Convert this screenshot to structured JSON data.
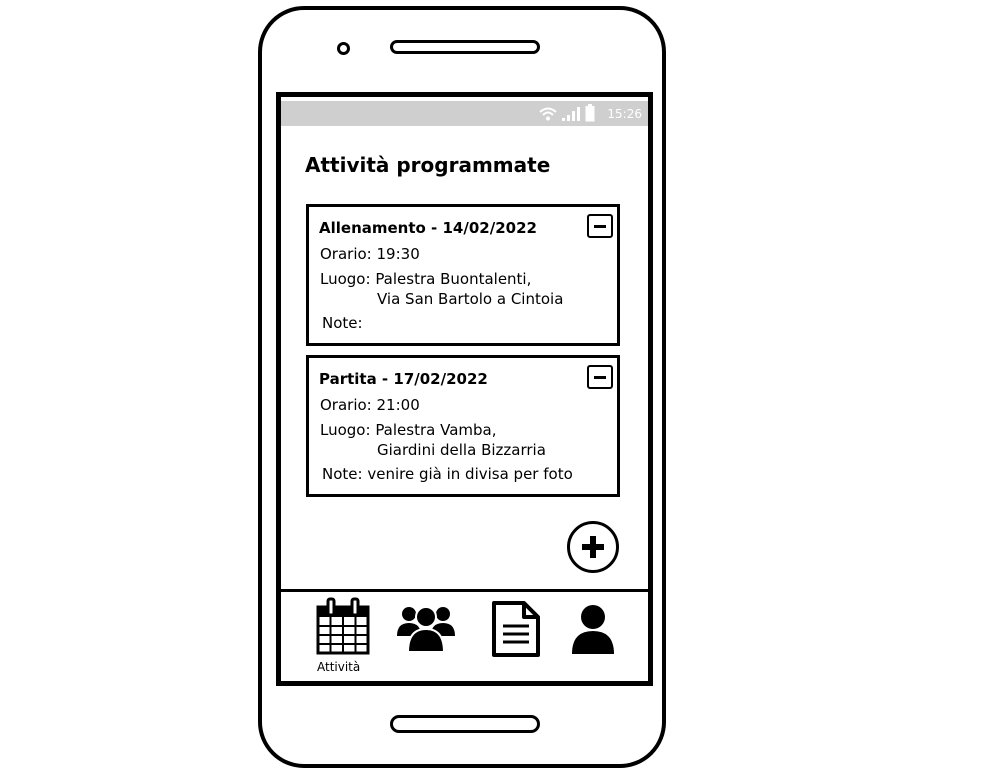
{
  "status_bar": {
    "time": "15:26"
  },
  "page": {
    "title": "Attività programmate"
  },
  "activities": [
    {
      "title": "Allenamento - 14/02/2022",
      "time_label": "Orario:",
      "time": "19:30",
      "place_label": "Luogo:",
      "place_line1": "Palestra Buontalenti,",
      "place_line2": "Via San Bartolo a Cintoia",
      "notes_label": "Note:",
      "notes": ""
    },
    {
      "title": "Partita - 17/02/2022",
      "time_label": "Orario:",
      "time": "21:00",
      "place_label": "Luogo:",
      "place_line1": "Palestra Vamba,",
      "place_line2": "Giardini della Bizzarria",
      "notes_label": "Note:",
      "notes": "venire già in divisa per foto"
    }
  ],
  "nav": {
    "items": [
      {
        "icon": "calendar-icon",
        "label": "Attività"
      },
      {
        "icon": "group-icon",
        "label": ""
      },
      {
        "icon": "document-icon",
        "label": ""
      },
      {
        "icon": "profile-icon",
        "label": ""
      }
    ]
  }
}
